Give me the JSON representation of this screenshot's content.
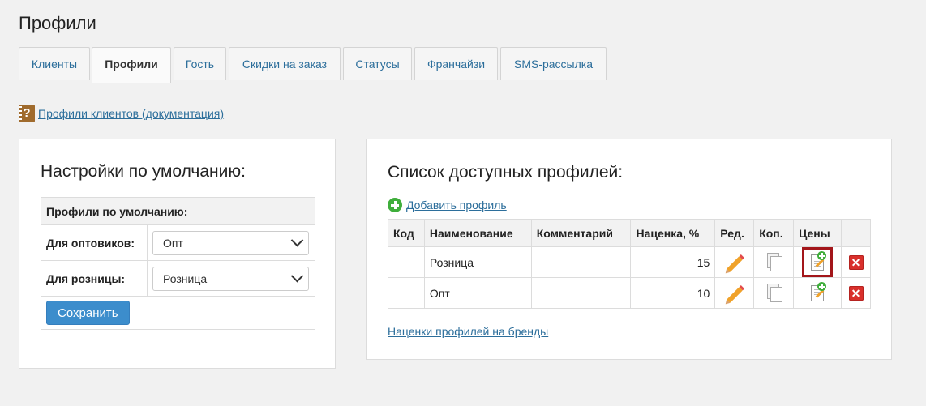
{
  "page": {
    "title": "Профили"
  },
  "tabs": [
    {
      "label": "Клиенты",
      "active": false
    },
    {
      "label": "Профили",
      "active": true
    },
    {
      "label": "Гость",
      "active": false
    },
    {
      "label": "Скидки на заказ",
      "active": false
    },
    {
      "label": "Статусы",
      "active": false
    },
    {
      "label": "Франчайзи",
      "active": false
    },
    {
      "label": "SMS-рассылка",
      "active": false
    }
  ],
  "doc_link": {
    "icon": "help-book-icon",
    "label": "Профили клиентов (документация)"
  },
  "defaults": {
    "heading": "Настройки по умолчанию:",
    "table_header": "Профили по умолчанию:",
    "rows": [
      {
        "label": "Для оптовиков:",
        "value": "Опт"
      },
      {
        "label": "Для розницы:",
        "value": "Розница"
      }
    ],
    "save_label": "Сохранить"
  },
  "profiles": {
    "heading": "Список доступных профилей:",
    "add_label": "Добавить профиль",
    "columns": [
      "Код",
      "Наименование",
      "Комментарий",
      "Наценка, %",
      "Ред.",
      "Коп.",
      "Цены",
      ""
    ],
    "rows": [
      {
        "code": "",
        "name": "Розница",
        "comment": "",
        "markup": "15",
        "price_highlighted": true
      },
      {
        "code": "",
        "name": "Опт",
        "comment": "",
        "markup": "10",
        "price_highlighted": false
      }
    ],
    "brands_link": "Наценки профилей на бренды"
  },
  "colors": {
    "link": "#2c6e9b",
    "primary_button": "#3c8dcc",
    "delete": "#d9302c",
    "add": "#3fae3b",
    "highlight": "#a3161a"
  }
}
